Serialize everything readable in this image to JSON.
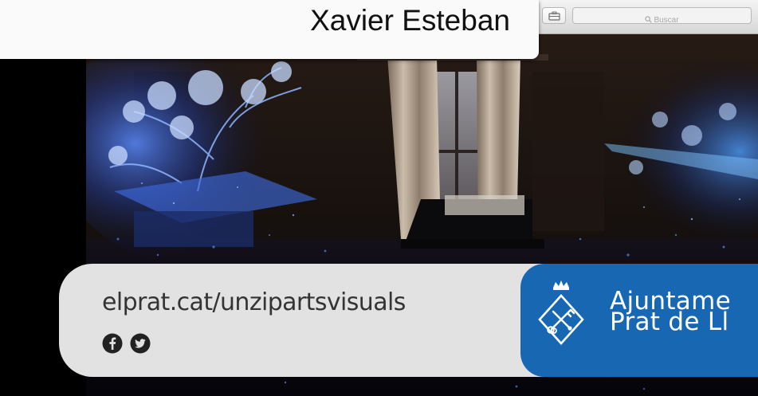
{
  "header": {
    "author_name": "Xavier Esteban"
  },
  "toolbar": {
    "search_placeholder": "Buscar",
    "briefcase_icon": "briefcase-icon",
    "search_icon": "magnifier-icon"
  },
  "banner": {
    "url": "elprat.cat/unzipartsvisuals",
    "social_icons": [
      "facebook-icon",
      "twitter-icon"
    ],
    "organization_line1": "Ajuntame",
    "organization_line2": "Prat de Ll",
    "emblem": "town-crest-emblem"
  },
  "colors": {
    "banner_gray": "#e2e2e2",
    "url_text": "#343434",
    "brand_blue": "#1767b3",
    "name_tab": "#fafafa"
  }
}
